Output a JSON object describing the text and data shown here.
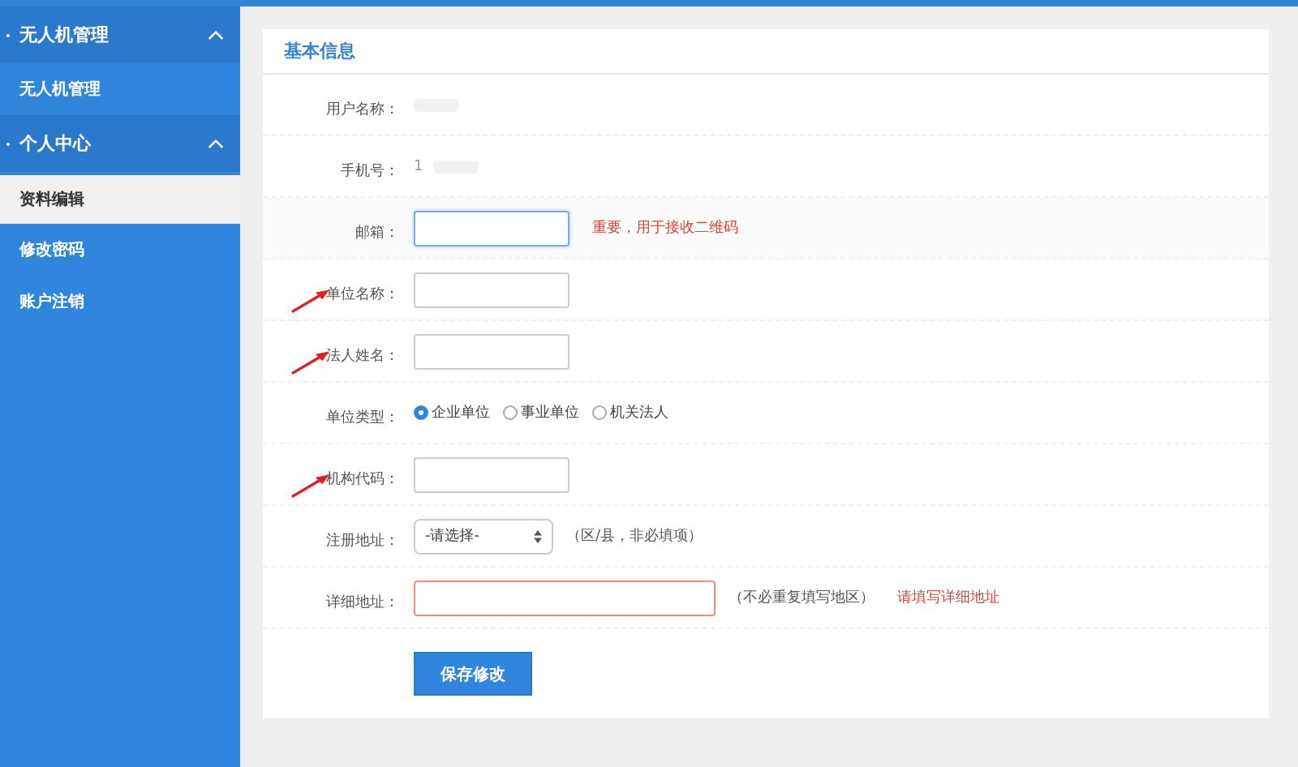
{
  "sidebar": {
    "groups": [
      {
        "title": "无人机管理",
        "expanded": true,
        "items": [
          {
            "label": "无人机管理",
            "selected": false
          }
        ]
      },
      {
        "title": "个人中心",
        "expanded": true,
        "items": [
          {
            "label": "资料编辑",
            "selected": true
          },
          {
            "label": "修改密码",
            "selected": false
          },
          {
            "label": "账户注销",
            "selected": false
          }
        ]
      }
    ]
  },
  "panel": {
    "title": "基本信息",
    "rows": [
      {
        "kind": "static",
        "label": "用户名称：",
        "arrow": false
      },
      {
        "kind": "static",
        "label": "手机号：",
        "value": "1",
        "arrow": false
      },
      {
        "kind": "text",
        "label": "邮箱：",
        "focused": true,
        "error": false,
        "wide": false,
        "message": "重要，用于接收二维码",
        "arrow": false
      },
      {
        "kind": "text",
        "label": "单位名称：",
        "focused": false,
        "error": false,
        "wide": false,
        "arrow": true
      },
      {
        "kind": "text",
        "label": "法人姓名：",
        "focused": false,
        "error": false,
        "wide": false,
        "arrow": true
      },
      {
        "kind": "radio",
        "label": "单位类型：",
        "options": [
          {
            "label": "企业单位",
            "selected": true
          },
          {
            "label": "事业单位",
            "selected": false
          },
          {
            "label": "机关法人",
            "selected": false
          }
        ],
        "arrow": false
      },
      {
        "kind": "text",
        "label": "机构代码：",
        "focused": false,
        "error": false,
        "wide": false,
        "arrow": true
      },
      {
        "kind": "select",
        "label": "注册地址：",
        "value": "-请选择-",
        "note": "（区/县，非必填项）",
        "arrow": false
      },
      {
        "kind": "text",
        "label": "详细地址：",
        "focused": false,
        "error": true,
        "wide": true,
        "note": "（不必重复填写地区）",
        "message": "请填写详细地址",
        "arrow": false
      }
    ],
    "save_button": "保存修改"
  }
}
